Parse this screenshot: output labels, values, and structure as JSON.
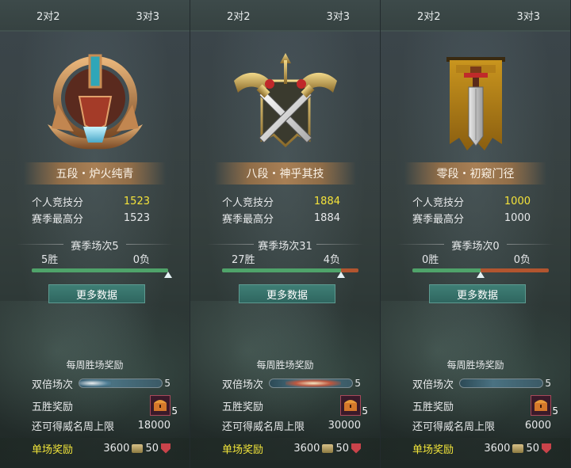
{
  "panels": [
    {
      "tabs": [
        "2对2",
        "3对3"
      ],
      "emblem": "rank-5-emblem",
      "rank_title": "五段・炉火纯青",
      "stats": [
        {
          "label": "个人竞技分",
          "value": "1523",
          "highlight": true
        },
        {
          "label": "赛季最高分",
          "value": "1523",
          "highlight": false
        }
      ],
      "season_title": "赛季场次5",
      "wins": "5胜",
      "losses": "0负",
      "win_ratio": 1.0,
      "more_button": "更多数据",
      "weekly_title": "每周胜场奖励",
      "double_label": "双倍场次",
      "double_count": "5",
      "five_win_label": "五胜奖励",
      "five_win_count": "5",
      "cap_label": "还可得威名周上限",
      "cap_value": "18000",
      "match_reward_label": "单场奖励",
      "match_reward_coin": "3600",
      "match_reward_shield": "50"
    },
    {
      "tabs": [
        "2对2",
        "3对3"
      ],
      "emblem": "rank-8-emblem",
      "rank_title": "八段・神乎其技",
      "stats": [
        {
          "label": "个人竞技分",
          "value": "1884",
          "highlight": true
        },
        {
          "label": "赛季最高分",
          "value": "1884",
          "highlight": false
        }
      ],
      "season_title": "赛季场次31",
      "wins": "27胜",
      "losses": "4负",
      "win_ratio": 0.87,
      "more_button": "更多数据",
      "weekly_title": "每周胜场奖励",
      "double_label": "双倍场次",
      "double_count": "5",
      "five_win_label": "五胜奖励",
      "five_win_count": "5",
      "cap_label": "还可得威名周上限",
      "cap_value": "30000",
      "match_reward_label": "单场奖励",
      "match_reward_coin": "3600",
      "match_reward_shield": "50"
    },
    {
      "tabs": [
        "2对2",
        "3对3"
      ],
      "emblem": "rank-0-emblem",
      "rank_title": "零段・初窥门径",
      "stats": [
        {
          "label": "个人竞技分",
          "value": "1000",
          "highlight": true
        },
        {
          "label": "赛季最高分",
          "value": "1000",
          "highlight": false
        }
      ],
      "season_title": "赛季场次0",
      "wins": "0胜",
      "losses": "0负",
      "win_ratio": 0.5,
      "more_button": "更多数据",
      "weekly_title": "每周胜场奖励",
      "double_label": "双倍场次",
      "double_count": "5",
      "five_win_label": "五胜奖励",
      "five_win_count": "5",
      "cap_label": "还可得威名周上限",
      "cap_value": "6000",
      "match_reward_label": "单场奖励",
      "match_reward_coin": "3600",
      "match_reward_shield": "50"
    }
  ],
  "colors": {
    "highlight": "#f5e33a",
    "win_bar": "#4fa36a",
    "loss_bar": "#b2552f",
    "button": "#3f7f76"
  }
}
